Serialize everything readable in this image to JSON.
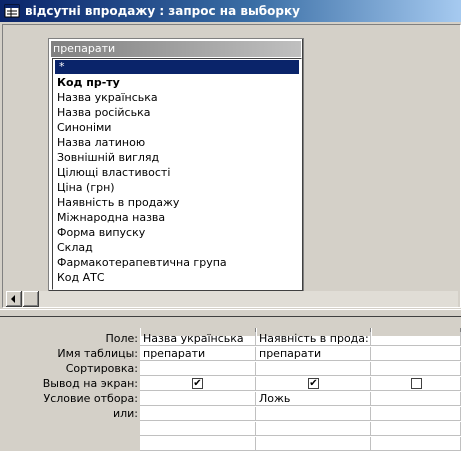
{
  "window": {
    "title": "відсутні впродажу : запрос на выборку"
  },
  "table": {
    "name": "препарати",
    "fields": [
      "*",
      "Код пр-ту",
      "Назва українська",
      "Назва російська",
      "Синоніми",
      "Назва латиною",
      "Зовнішній вигляд",
      "Цілющі властивості",
      "Ціна (грн)",
      "Наявність в продажу",
      "Міжнародна назва",
      "Форма випуску",
      "Склад",
      "Фармакотерапевтична група",
      "Код АТС"
    ],
    "selected_index": 0,
    "bold_index": 1
  },
  "grid": {
    "row_labels": [
      "Поле:",
      "Имя таблицы:",
      "Сортировка:",
      "Вывод на экран:",
      "Условие отбора:",
      "или:"
    ],
    "columns": [
      {
        "field": "Назва українська",
        "table": "препарати",
        "sort": "",
        "show": true,
        "criteria": "",
        "or": ""
      },
      {
        "field": "Наявність в прода:",
        "table": "препарати",
        "sort": "",
        "show": true,
        "criteria": "Ложь",
        "or": ""
      },
      {
        "field": "",
        "table": "",
        "sort": "",
        "show": false,
        "criteria": "",
        "or": ""
      }
    ]
  },
  "colors": {
    "title_start": "#0a246a",
    "title_end": "#a6caf0",
    "selection": "#0a246a"
  }
}
